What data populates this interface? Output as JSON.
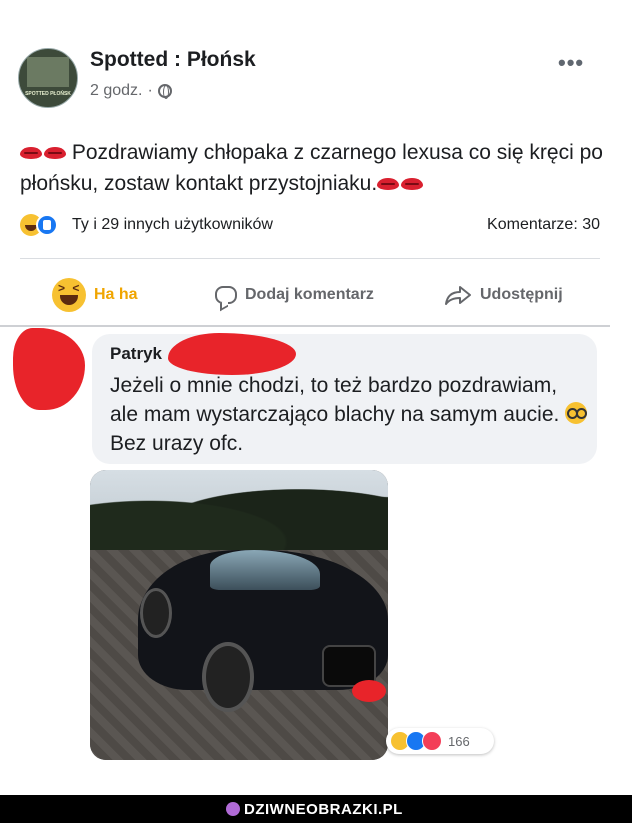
{
  "post": {
    "page_name": "Spotted : Płońsk",
    "avatar_text": "SPOTTED PŁOŃSK",
    "time": "2 godz.",
    "time_separator": "·",
    "more_glyph": "•••",
    "text": "Pozdrawiamy chłopaka z czarnego lexusa co się kręci po płońsku, zostaw kontakt przystojniaku.",
    "reactions_summary": "Ty i 29 innych użytkowników",
    "comments_count": "Komentarze: 30"
  },
  "actions": {
    "reaction_label": "Ha ha",
    "comment_label": "Dodaj komentarz",
    "share_label": "Udostępnij"
  },
  "comment": {
    "author": "Patryk",
    "text_before_emoji": "Jeżeli o mnie chodzi, to też bardzo pozdrawiam, ale mam wystarczająco blachy na samym aucie.",
    "text_after_emoji": "Bez urazy ofc.",
    "reaction_count": "166"
  },
  "watermark": {
    "text": "DZIWNEOBRAZKI.PL"
  },
  "colors": {
    "redaction": "#e8242a",
    "haha_accent": "#f0a500",
    "like_blue": "#1877f2"
  },
  "icons": [
    "globe-icon",
    "more-icon",
    "lips-emoji",
    "haha-emoji",
    "like-emoji",
    "comment-icon",
    "share-icon",
    "nerd-emoji",
    "love-emoji"
  ]
}
